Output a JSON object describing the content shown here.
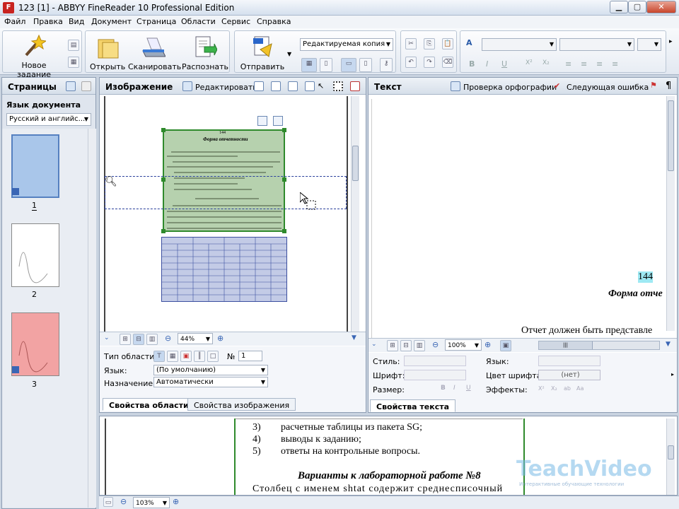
{
  "window": {
    "title": "123 [1] - ABBYY FineReader 10 Professional Edition",
    "minimize": "▁",
    "maximize": "▢",
    "close": "✕"
  },
  "menu": [
    "Файл",
    "Правка",
    "Вид",
    "Документ",
    "Страница",
    "Области",
    "Сервис",
    "Справка"
  ],
  "toolbar": {
    "new_task": "Новое задание",
    "open": "Открыть",
    "scan": "Сканировать",
    "recognize": "Распознать",
    "send": "Отправить",
    "copy_mode": "Редактируемая копия"
  },
  "pages_panel": {
    "title": "Страницы",
    "lang_label": "Язык документа",
    "lang_value": "Русский и английс...",
    "pages": [
      "1",
      "2",
      "3"
    ]
  },
  "image_panel": {
    "title": "Изображение",
    "edit_btn": "Редактировать",
    "zoom": "44%",
    "doc_page_num": "144",
    "doc_heading": "Форма отчетности"
  },
  "area_props": {
    "type_label": "Тип области:",
    "num_label": "№",
    "num_value": "1",
    "lang_label": "Язык:",
    "lang_value": "(По умолчанию)",
    "purpose_label": "Назначение:",
    "purpose_value": "Автоматически",
    "tab_area": "Свойства области",
    "tab_image": "Свойства изображения"
  },
  "text_panel": {
    "title": "Текст",
    "spell_btn": "Проверка орфографии",
    "next_error_btn": "Следующая ошибка",
    "page_num": "144",
    "heading": "Форма отче",
    "line1": "Отчет должен быть представле",
    "zoom": "100%"
  },
  "text_props": {
    "style_label": "Стиль:",
    "font_label": "Шрифт:",
    "size_label": "Размер:",
    "lang_label": "Язык:",
    "color_label": "Цвет шрифта:",
    "color_value": "(нет)",
    "effects_label": "Эффекты:",
    "tab_text": "Свойства текста"
  },
  "zoom_view": {
    "lines": [
      "3)",
      "расчетные таблицы из пакета SG;",
      "4)",
      "выводы к заданию;",
      "5)",
      "ответы на контрольные вопросы."
    ],
    "variants_heading": "Варианты к лабораторной работе №8",
    "last_line": "Столбец с именем shtat содержит среднесписочный",
    "zoom": "103%"
  },
  "watermark": {
    "brand": "TeachVideo",
    "tagline": "Интерактивные обучающие технологии"
  }
}
